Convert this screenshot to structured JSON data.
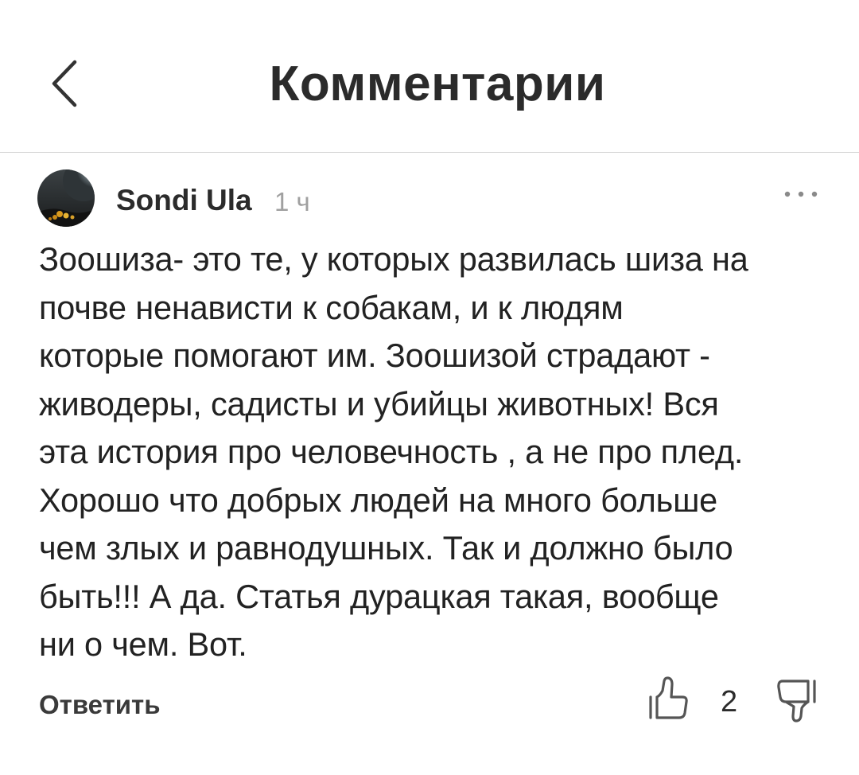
{
  "header": {
    "title": "Комментарии",
    "back_icon": "chevron-left-icon"
  },
  "comment": {
    "author": "Sondi Ula",
    "time": "1 ч",
    "more_icon": "more-horizontal-icon",
    "text": "Зоошиза- это те, у которых развилась шиза на\nпочве ненависти к собакам, и к людям\nкоторые помогают им. Зоошизой страдают -\nживодеры, садисты и убийцы животных! Вся\nэта история про человечность , а не про плед.\nХорошо что добрых людей на много больше\nчем злых и равнодушных. Так и должно было\nбыть!!! А да. Статья дурацкая такая, вообще\nни о чем. Вот.",
    "reply_label": "Ответить",
    "like_icon": "thumbs-up-icon",
    "like_count": "2",
    "dislike_icon": "thumbs-down-icon"
  }
}
